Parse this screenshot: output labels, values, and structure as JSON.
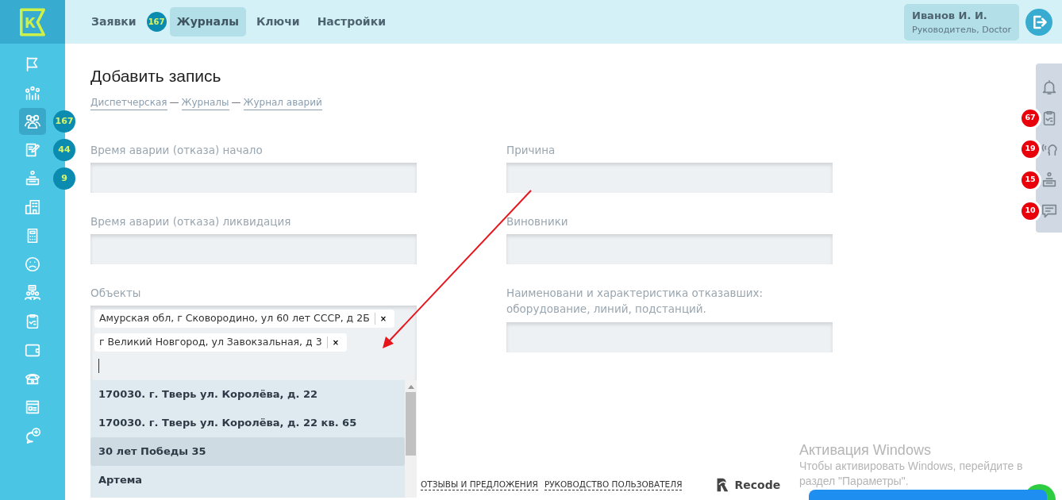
{
  "logo": {
    "letter": "К"
  },
  "topnav": [
    {
      "label": "Заявки",
      "badge": "167",
      "selected": false
    },
    {
      "label": "Журналы",
      "selected": true
    },
    {
      "label": "Ключи",
      "selected": false
    },
    {
      "label": "Настройки",
      "selected": false
    }
  ],
  "user": {
    "name": "Иванов И. И.",
    "role": "Руководитель, Doctor"
  },
  "sidebar": {
    "items": [
      {
        "selected": false
      },
      {
        "selected": false
      },
      {
        "selected": true,
        "badge": "167"
      },
      {
        "selected": false,
        "badge": "44"
      },
      {
        "selected": false,
        "badge": "9"
      },
      {
        "selected": false
      },
      {
        "selected": false
      },
      {
        "selected": false
      },
      {
        "selected": false
      },
      {
        "selected": false
      },
      {
        "selected": false
      },
      {
        "selected": false
      },
      {
        "selected": false
      },
      {
        "selected": false
      }
    ]
  },
  "page": {
    "title": "Добавить запись",
    "breadcrumbs": [
      {
        "label": "Диспетчерская"
      },
      {
        "separator": "—",
        "label": "Журналы"
      },
      {
        "separator": "—",
        "label": "Журнал аварий"
      }
    ]
  },
  "form": {
    "left": [
      {
        "label": "Время аварии (отказа) начало",
        "kind": "text"
      },
      {
        "label": "Время аварии (отказа) ликвидация",
        "kind": "text"
      },
      {
        "label": "Объекты",
        "kind": "tags",
        "tags": [
          {
            "label": "Амурская обл, г Сковородино, ул 60 лет СССР, д 2Б",
            "remove": "×"
          },
          {
            "label": "г Великий Новгород, ул Завокзальная, д 3",
            "remove": "×"
          }
        ],
        "options": [
          {
            "label": "170030. г. Тверь ул. Королёва, д. 22",
            "selected": false
          },
          {
            "label": "170030. г. Тверь ул. Королёва, д. 22 кв. 65",
            "selected": false
          },
          {
            "label": "30 лет Победы 35",
            "selected": true
          },
          {
            "label": "Артема",
            "selected": false
          }
        ]
      }
    ],
    "right": [
      {
        "label": "Причина",
        "kind": "text"
      },
      {
        "label": "Виновники",
        "kind": "text"
      },
      {
        "label": "Наименовани и характеристика отказавших: оборудование, линий, подстанций.",
        "kind": "text"
      }
    ]
  },
  "right_panel": [
    {
      "kind": "bell"
    },
    {
      "kind": "tasks",
      "badge": "67"
    },
    {
      "kind": "speech",
      "badge": "19"
    },
    {
      "kind": "reception",
      "badge": "15"
    },
    {
      "kind": "messages",
      "badge": "10"
    }
  ],
  "footer": {
    "links": [
      "ОТЗЫВЫ И ПРЕДЛОЖЕНИЯ",
      "РУКОВОДСТВО ПОЛЬЗОВАТЕЛЯ"
    ],
    "brand": "Recode"
  },
  "os_notice": {
    "title": "Активация Windows",
    "text": "Чтобы активировать Windows, перейдите в раздел \"Параметры\"."
  }
}
